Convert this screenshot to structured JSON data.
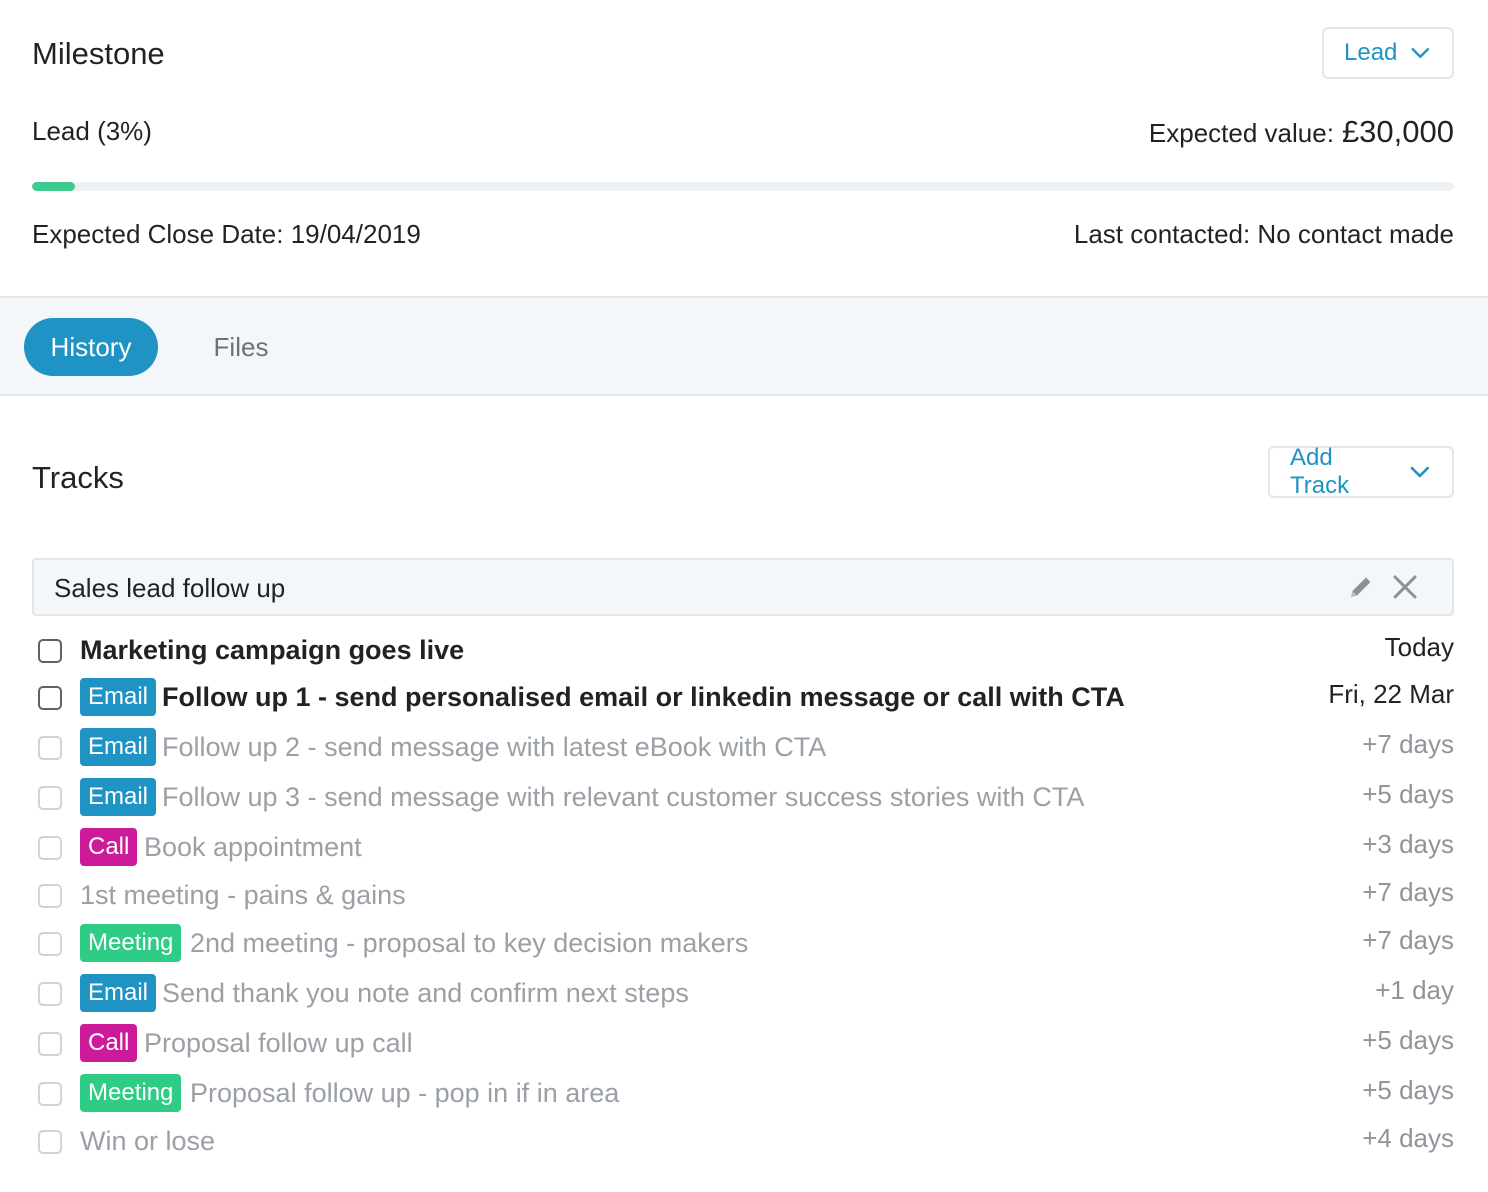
{
  "milestone": {
    "title": "Milestone",
    "stage_button": "Lead",
    "stage_label": "Lead (3%)",
    "progress": 0.03,
    "expected_value_label": "Expected value:",
    "expected_value": "£30,000",
    "close_date": "Expected Close Date: 19/04/2019",
    "last_contacted": "Last contacted: No contact made"
  },
  "tabs": [
    {
      "label": "History",
      "active": true
    },
    {
      "label": "Files",
      "active": false
    }
  ],
  "tracks": {
    "title": "Tracks",
    "add_button": "Add Track",
    "track_name": "Sales lead follow up",
    "tasks": [
      {
        "tag": "",
        "text": "Marketing campaign goes live",
        "when": "Today",
        "active": true
      },
      {
        "tag": "Email",
        "text": "Follow up 1 - send personalised email or linkedin message or call with CTA",
        "when": "Fri, 22 Mar",
        "active": true
      },
      {
        "tag": "Email",
        "text": "Follow up 2 - send message with latest eBook with CTA",
        "when": "+7 days",
        "active": false
      },
      {
        "tag": "Email",
        "text": "Follow up 3 - send message with relevant customer success stories with CTA",
        "when": "+5 days",
        "active": false
      },
      {
        "tag": "Call",
        "text": "Book appointment",
        "when": "+3 days",
        "active": false
      },
      {
        "tag": "",
        "text": "1st meeting - pains & gains",
        "when": "+7 days",
        "active": false
      },
      {
        "tag": "Meeting",
        "text": "2nd meeting - proposal to key decision makers",
        "when": "+7 days",
        "active": false
      },
      {
        "tag": "Email",
        "text": "Send thank you note and confirm next steps",
        "when": "+1 day",
        "active": false
      },
      {
        "tag": "Call",
        "text": "Proposal follow up call",
        "when": "+5 days",
        "active": false
      },
      {
        "tag": "Meeting",
        "text": "Proposal follow up - pop in if in area",
        "when": "+5 days",
        "active": false
      },
      {
        "tag": "",
        "text": "Win or lose",
        "when": "+4 days",
        "active": false
      }
    ]
  },
  "icons": [
    "chevron-down-icon",
    "pencil-icon",
    "close-icon",
    "checkbox-icon"
  ],
  "colors": {
    "accent": "#1f93c4",
    "progress": "#3fcb8f",
    "email_tag": "#1f93c4",
    "call_tag": "#cc1a98",
    "meeting_tag": "#2ecc85"
  }
}
